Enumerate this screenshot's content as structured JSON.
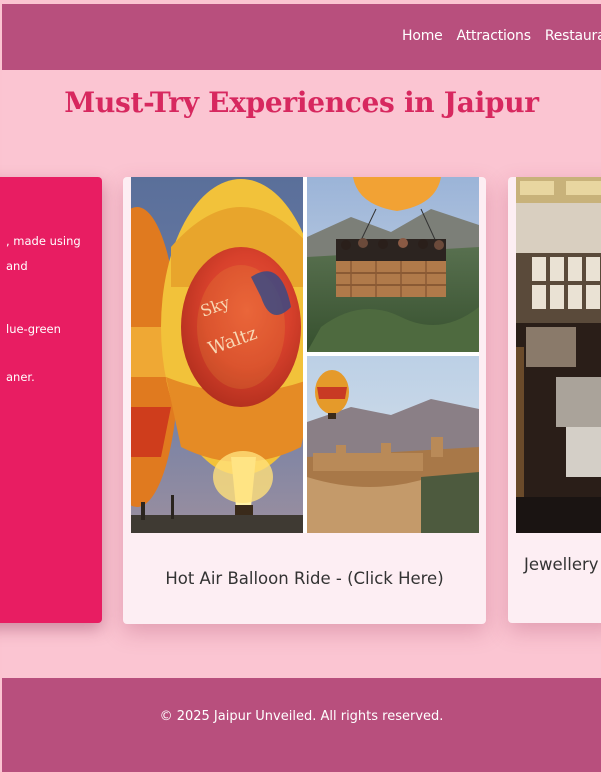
{
  "nav": {
    "links": [
      "Home",
      "Attractions",
      "Restaurants"
    ]
  },
  "hero": {
    "title": "Must-Try Experiences in Jaipur"
  },
  "cards": {
    "left_lines": [
      ", made using",
      "and",
      "lue-green",
      "aner."
    ],
    "main": {
      "caption": "Hot Air Balloon Ride - (Click Here)",
      "balloon_text": [
        "Sky",
        "Waltz"
      ]
    },
    "right": {
      "caption": "Jewellery"
    }
  },
  "footer": {
    "text": "© 2025 Jaipur Unveiled. All rights reserved."
  },
  "colors": {
    "navbar": "#b84f7d",
    "background": "#fbc5d2",
    "title": "#d7285f",
    "card_accent": "#e81d62"
  }
}
